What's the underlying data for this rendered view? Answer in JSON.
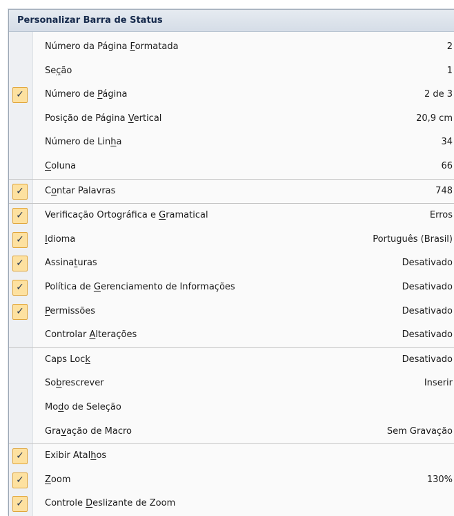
{
  "menu": {
    "title": "Personalizar Barra de Status",
    "items": [
      {
        "pre": "Número da Página ",
        "key": "F",
        "post": "ormatada",
        "value": "2",
        "checked": false
      },
      {
        "pre": "Se",
        "key": "ç",
        "post": "ão",
        "value": "1",
        "checked": false
      },
      {
        "pre": "Número de ",
        "key": "P",
        "post": "ágina",
        "value": "2 de 3",
        "checked": true
      },
      {
        "pre": "Posição de Página ",
        "key": "V",
        "post": "ertical",
        "value": "20,9 cm",
        "checked": false
      },
      {
        "pre": "Número de Lin",
        "key": "h",
        "post": "a",
        "value": "34",
        "checked": false
      },
      {
        "pre": "",
        "key": "C",
        "post": "oluna",
        "value": "66",
        "checked": false
      },
      {
        "pre": "C",
        "key": "o",
        "post": "ntar Palavras",
        "value": "748",
        "checked": true
      },
      {
        "pre": "Verificação Ortográfica e ",
        "key": "G",
        "post": "ramatical",
        "value": "Erros",
        "checked": true
      },
      {
        "pre": "",
        "key": "I",
        "post": "dioma",
        "value": "Português (Brasil)",
        "checked": true
      },
      {
        "pre": "Assina",
        "key": "t",
        "post": "uras",
        "value": "Desativado",
        "checked": true
      },
      {
        "pre": "Política de ",
        "key": "G",
        "post": "erenciamento de Informações",
        "value": "Desativado",
        "checked": true
      },
      {
        "pre": "",
        "key": "P",
        "post": "ermissões",
        "value": "Desativado",
        "checked": true
      },
      {
        "pre": "Controlar ",
        "key": "A",
        "post": "lterações",
        "value": "Desativado",
        "checked": false
      },
      {
        "pre": "Caps Loc",
        "key": "k",
        "post": "",
        "value": "Desativado",
        "checked": false
      },
      {
        "pre": "So",
        "key": "b",
        "post": "rescrever",
        "value": "Inserir",
        "checked": false
      },
      {
        "pre": "Mo",
        "key": "d",
        "post": "o de Seleção",
        "value": "",
        "checked": false
      },
      {
        "pre": "Gra",
        "key": "v",
        "post": "ação de Macro",
        "value": "Sem Gravação",
        "checked": false
      },
      {
        "pre": "Exibir Atal",
        "key": "h",
        "post": "os",
        "value": "",
        "checked": true
      },
      {
        "pre": "",
        "key": "Z",
        "post": "oom",
        "value": "130%",
        "checked": true
      },
      {
        "pre": "Controle ",
        "key": "D",
        "post": "eslizante de Zoom",
        "value": "",
        "checked": true
      }
    ],
    "check_glyph": "✓",
    "check_icon": "checkmark-icon"
  }
}
